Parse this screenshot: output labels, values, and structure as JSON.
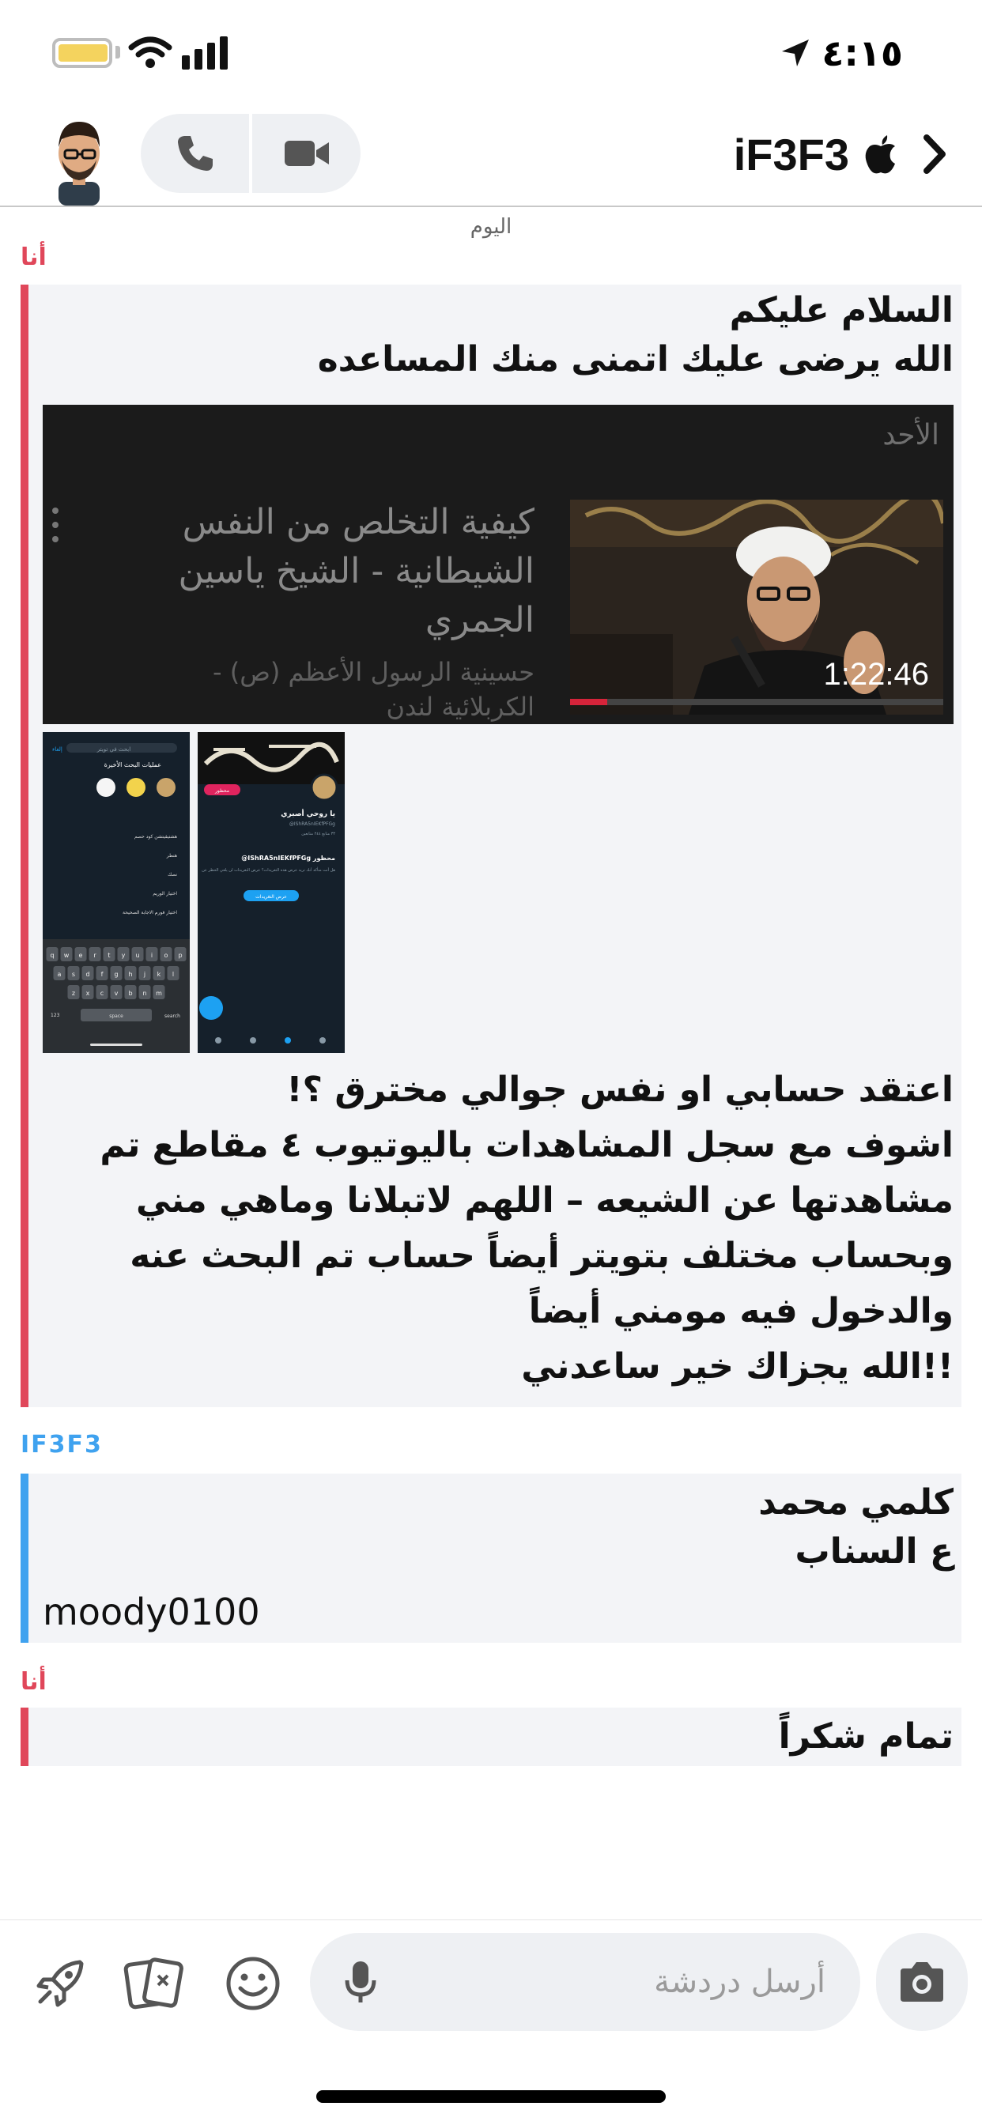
{
  "status_bar": {
    "time": "٤:١٥"
  },
  "header": {
    "title": "iF3F3",
    "icons": [
      "avatar",
      "phone-icon",
      "video-camera-icon",
      "apple-icon",
      "chevron-right-icon"
    ]
  },
  "chat": {
    "day_label": "اليوم",
    "messages": [
      {
        "sender": "أنا",
        "lines": [
          "السلام عليكم",
          "الله يرضى عليك اتمنى منك المساعده"
        ]
      },
      {
        "sender": "أنا",
        "lines": [
          "اعتقد حسابي او نفس جوالي مخترق ؟!",
          "اشوف مع سجل المشاهدات باليوتيوب ٤ مقاطع تم",
          "مشاهدتها عن الشيعه – اللهم لاتبلانا وماهي مني",
          "وبحساب مختلف بتويتر أيضاً حساب تم البحث عنه",
          "والدخول فيه مومني أيضاً",
          "!!الله يجزاك خير ساعدني"
        ]
      },
      {
        "sender": "IF3F3",
        "lines": [
          "كلمي محمد",
          "ع السناب"
        ],
        "extra": "moody0100"
      },
      {
        "sender": "أنا",
        "lines": [
          "تمام شكراً"
        ]
      }
    ]
  },
  "youtube_card": {
    "day": "الأحد",
    "title_lines": [
      "كيفية التخلص من النفس",
      "الشيطانية - الشيخ ياسين",
      "الجمري"
    ],
    "channel_lines": [
      "حسينية الرسول الأعظم (ص) -",
      "الكربلائية لندن"
    ],
    "duration": "1:22:46",
    "progress": 0.1
  },
  "screenshot_thumbs": {
    "shot1": {
      "search_placeholder": "ابحث في تويتر",
      "cancel": "إلغاء",
      "header": "عمليات البحث الأخيرة",
      "rows": [
        "هشتيقيتشن كود حصم",
        "هنطر",
        "نصك",
        "اختيار الوريم",
        "اختيار فورم الاجابة الصحيحة"
      ],
      "keyboard_rows": [
        [
          "q",
          "w",
          "e",
          "r",
          "t",
          "y",
          "u",
          "i",
          "o",
          "p"
        ],
        [
          "a",
          "s",
          "d",
          "f",
          "g",
          "h",
          "j",
          "k",
          "l"
        ],
        [
          "z",
          "x",
          "c",
          "v",
          "b",
          "n",
          "m"
        ]
      ],
      "space": "space",
      "search": "search",
      "num": "123"
    },
    "shot2": {
      "name": "يا روحي أصبري",
      "handle": "@IShRA5nIEKfPFGg",
      "blocked_title": "@IShRA5nIEKfPFGg محظور",
      "blocked_desc": "هل أنت متأكد أنك تريد عرض هذه التغريدات؟ عرض التغريدات لن يلغي الحظر عن",
      "view_button": "عرض التغريدات",
      "follow_badge": "محظور",
      "stats": "٣٣ متابع ٢٤٤ متابعين"
    }
  },
  "composer": {
    "placeholder": "أرسل دردشة",
    "icons": [
      "rocket-icon",
      "cards-icon",
      "smiley-icon",
      "mic-icon",
      "camera-icon"
    ]
  },
  "colors": {
    "me": "#e0475a",
    "them": "#3fa2ef",
    "bubble_bg": "#f3f4f7",
    "pill_bg": "#eef0f3"
  }
}
